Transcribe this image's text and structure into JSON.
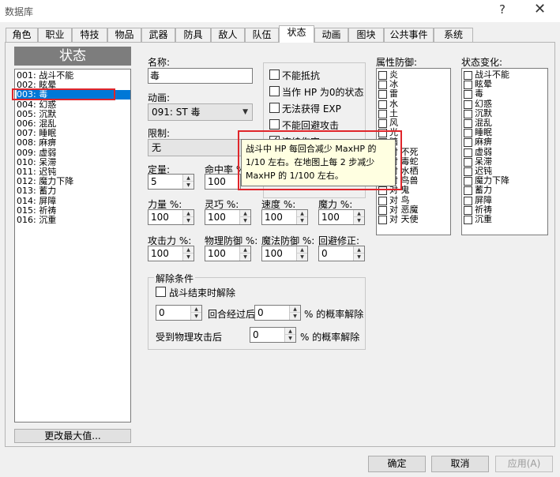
{
  "window": {
    "title": "数据库",
    "help": "?",
    "close": "✕"
  },
  "tabs": [
    {
      "label": "角色"
    },
    {
      "label": "职业"
    },
    {
      "label": "特技"
    },
    {
      "label": "物品"
    },
    {
      "label": "武器"
    },
    {
      "label": "防具"
    },
    {
      "label": "敌人"
    },
    {
      "label": "队伍"
    },
    {
      "label": "状态"
    },
    {
      "label": "动画"
    },
    {
      "label": "图块"
    },
    {
      "label": "公共事件"
    },
    {
      "label": "系统"
    }
  ],
  "state_list": {
    "header": "状态",
    "items": [
      "001: 战斗不能",
      "002: 眩晕",
      "003: 毒",
      "004: 幻惑",
      "005: 沉默",
      "006: 混乱",
      "007: 睡眠",
      "008: 麻痹",
      "009: 虚弱",
      "010: 呆滞",
      "011: 迟钝",
      "012: 魔力下降",
      "013: 蓄力",
      "014: 屏障",
      "015: 祈祷",
      "016: 沉重"
    ],
    "selected_index": 2,
    "change_max_button": "更改最大值..."
  },
  "form": {
    "name_label": "名称:",
    "name_value": "毒",
    "anim_label": "动画:",
    "anim_value": "091: ST 毒",
    "restrict_label": "限制:",
    "restrict_value": "无",
    "rating_label": "定量:",
    "rating_value": "5",
    "hit_label": "命中率 %:",
    "hit_value": "100",
    "stats": [
      {
        "label": "力量 %:",
        "value": "100"
      },
      {
        "label": "灵巧 %:",
        "value": "100"
      },
      {
        "label": "速度 %:",
        "value": "100"
      },
      {
        "label": "魔力 %:",
        "value": "100"
      },
      {
        "label": "攻击力 %:",
        "value": "100"
      },
      {
        "label": "物理防御 %:",
        "value": "100"
      },
      {
        "label": "魔法防御 %:",
        "value": "100"
      },
      {
        "label": "回避修正:",
        "value": "0"
      }
    ],
    "release": {
      "title": "解除条件",
      "battle_end_label": "战斗结束时解除",
      "turns_value": "0",
      "turns_label": "回合经过后",
      "turns_pct": "0",
      "pct_label": "% 的概率解除",
      "phys_label": "受到物理攻击后",
      "phys_pct": "0",
      "phys_pct_label": "% 的概率解除"
    }
  },
  "options": [
    {
      "label": "不能抵抗",
      "checked": false
    },
    {
      "label": "当作 HP 为0的状态",
      "checked": false
    },
    {
      "label": "无法获得 EXP",
      "checked": false
    },
    {
      "label": "不能回避攻击",
      "checked": false
    },
    {
      "label": "连续伤害",
      "checked": true
    }
  ],
  "tooltip": {
    "line1": "战斗中 HP 每回合减少 MaxHP 的",
    "line2": "1/10 左右。在地图上每 2 步减少",
    "line3": "MaxHP 的 1/100 左右。"
  },
  "elements": {
    "title": "属性防御:",
    "items": [
      "炎",
      "冰",
      "雷",
      "水",
      "土",
      "风",
      "光",
      "暗",
      "对 不死",
      "对 毒蛇",
      "对 水栖",
      "对 鸟兽",
      "对 鬼",
      "对 鸟",
      "对 恶魔",
      "对 天使"
    ]
  },
  "state_changes": {
    "title": "状态变化:",
    "items": [
      "战斗不能",
      "眩晕",
      "毒",
      "幻惑",
      "沉默",
      "混乱",
      "睡眠",
      "麻痹",
      "虚弱",
      "呆滞",
      "迟钝",
      "魔力下降",
      "蓄力",
      "屏障",
      "祈祷",
      "沉重"
    ]
  },
  "footer": {
    "ok": "确定",
    "cancel": "取消",
    "apply": "应用(A)"
  },
  "colors": {
    "selection": "#0078d7",
    "highlight_box": "#e0262b",
    "tooltip_bg": "#ffffe1"
  }
}
